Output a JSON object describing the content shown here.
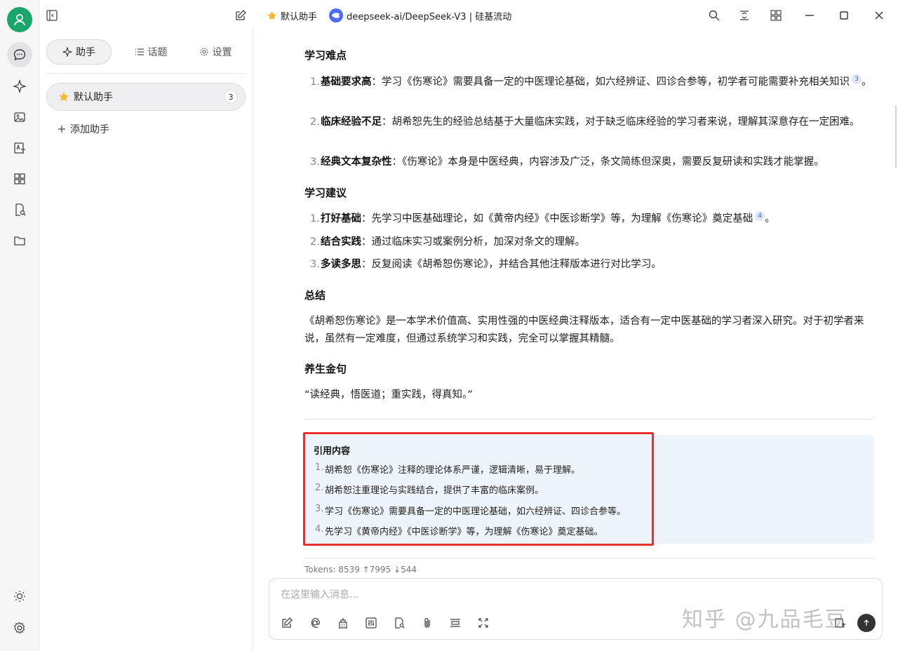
{
  "topbar": {
    "assistant_label": "默认助手",
    "model_label": "deepseek-ai/DeepSeek-V3 | 硅基流动"
  },
  "panel": {
    "tabs": [
      {
        "label": "助手"
      },
      {
        "label": "话题"
      },
      {
        "label": "设置"
      }
    ],
    "assistant": {
      "name": "默认助手",
      "count": "3"
    },
    "add_label": "添加助手"
  },
  "chat": {
    "sections": [
      {
        "heading": "学习难点",
        "items": [
          {
            "num": "1.",
            "bold": "基础要求高",
            "text": "：学习《伤寒论》需要具备一定的中医理论基础，如六经辨证、四诊合参等，初学者可能需要补充相关知识",
            "cite": "3",
            "tail": "。"
          },
          {
            "num": "2.",
            "bold": "临床经验不足",
            "text": "：胡希恕先生的经验总结基于大量临床实践，对于缺乏临床经验的学习者来说，理解其深意存在一定困难。"
          },
          {
            "num": "3.",
            "bold": "经典文本复杂性",
            "text": "：《伤寒论》本身是中医经典，内容涉及广泛，条文简练但深奥，需要反复研读和实践才能掌握。"
          }
        ]
      },
      {
        "heading": "学习建议",
        "items": [
          {
            "num": "1.",
            "bold": "打好基础",
            "text": "：先学习中医基础理论，如《黄帝内经》《中医诊断学》等，为理解《伤寒论》奠定基础",
            "cite": "4",
            "tail": "。"
          },
          {
            "num": "2.",
            "bold": "结合实践",
            "text": "：通过临床实习或案例分析，加深对条文的理解。"
          },
          {
            "num": "3.",
            "bold": "多读多思",
            "text": "：反复阅读《胡希恕伤寒论》，并结合其他注释版本进行对比学习。"
          }
        ]
      }
    ],
    "summary_heading": "总结",
    "summary_text": "《胡希恕伤寒论》是一本学术价值高、实用性强的中医经典注释版本，适合有一定中医基础的学习者深入研究。对于初学者来说，虽然有一定难度，但通过系统学习和实践，完全可以掌握其精髓。",
    "motto_heading": "养生金句",
    "motto_text": "“读经典，悟医道；重实践，得真知。”"
  },
  "citations": {
    "title": "引用内容",
    "items": [
      {
        "num": "1.",
        "text": "胡希恕《伤寒论》注释的理论体系严谨，逻辑清晰，易于理解。"
      },
      {
        "num": "2.",
        "text": "胡希恕注重理论与实践结合，提供了丰富的临床案例。"
      },
      {
        "num": "3.",
        "text": "学习《伤寒论》需要具备一定的中医理论基础，如六经辨证、四诊合参等。"
      },
      {
        "num": "4.",
        "text": "先学习《黄帝内经》《中医诊断学》等，为理解《伤寒论》奠定基础。"
      }
    ]
  },
  "tokens": "Tokens: 8539 ↑7995 ↓544",
  "input": {
    "placeholder": "在这里输入消息..."
  },
  "watermark": "知乎 @九品毛豆",
  "colors": {
    "accent_green": "#1aa56b",
    "highlight_red": "#e53131",
    "quote_bg": "#eef4fb",
    "model_blue": "#4d6bfe"
  }
}
